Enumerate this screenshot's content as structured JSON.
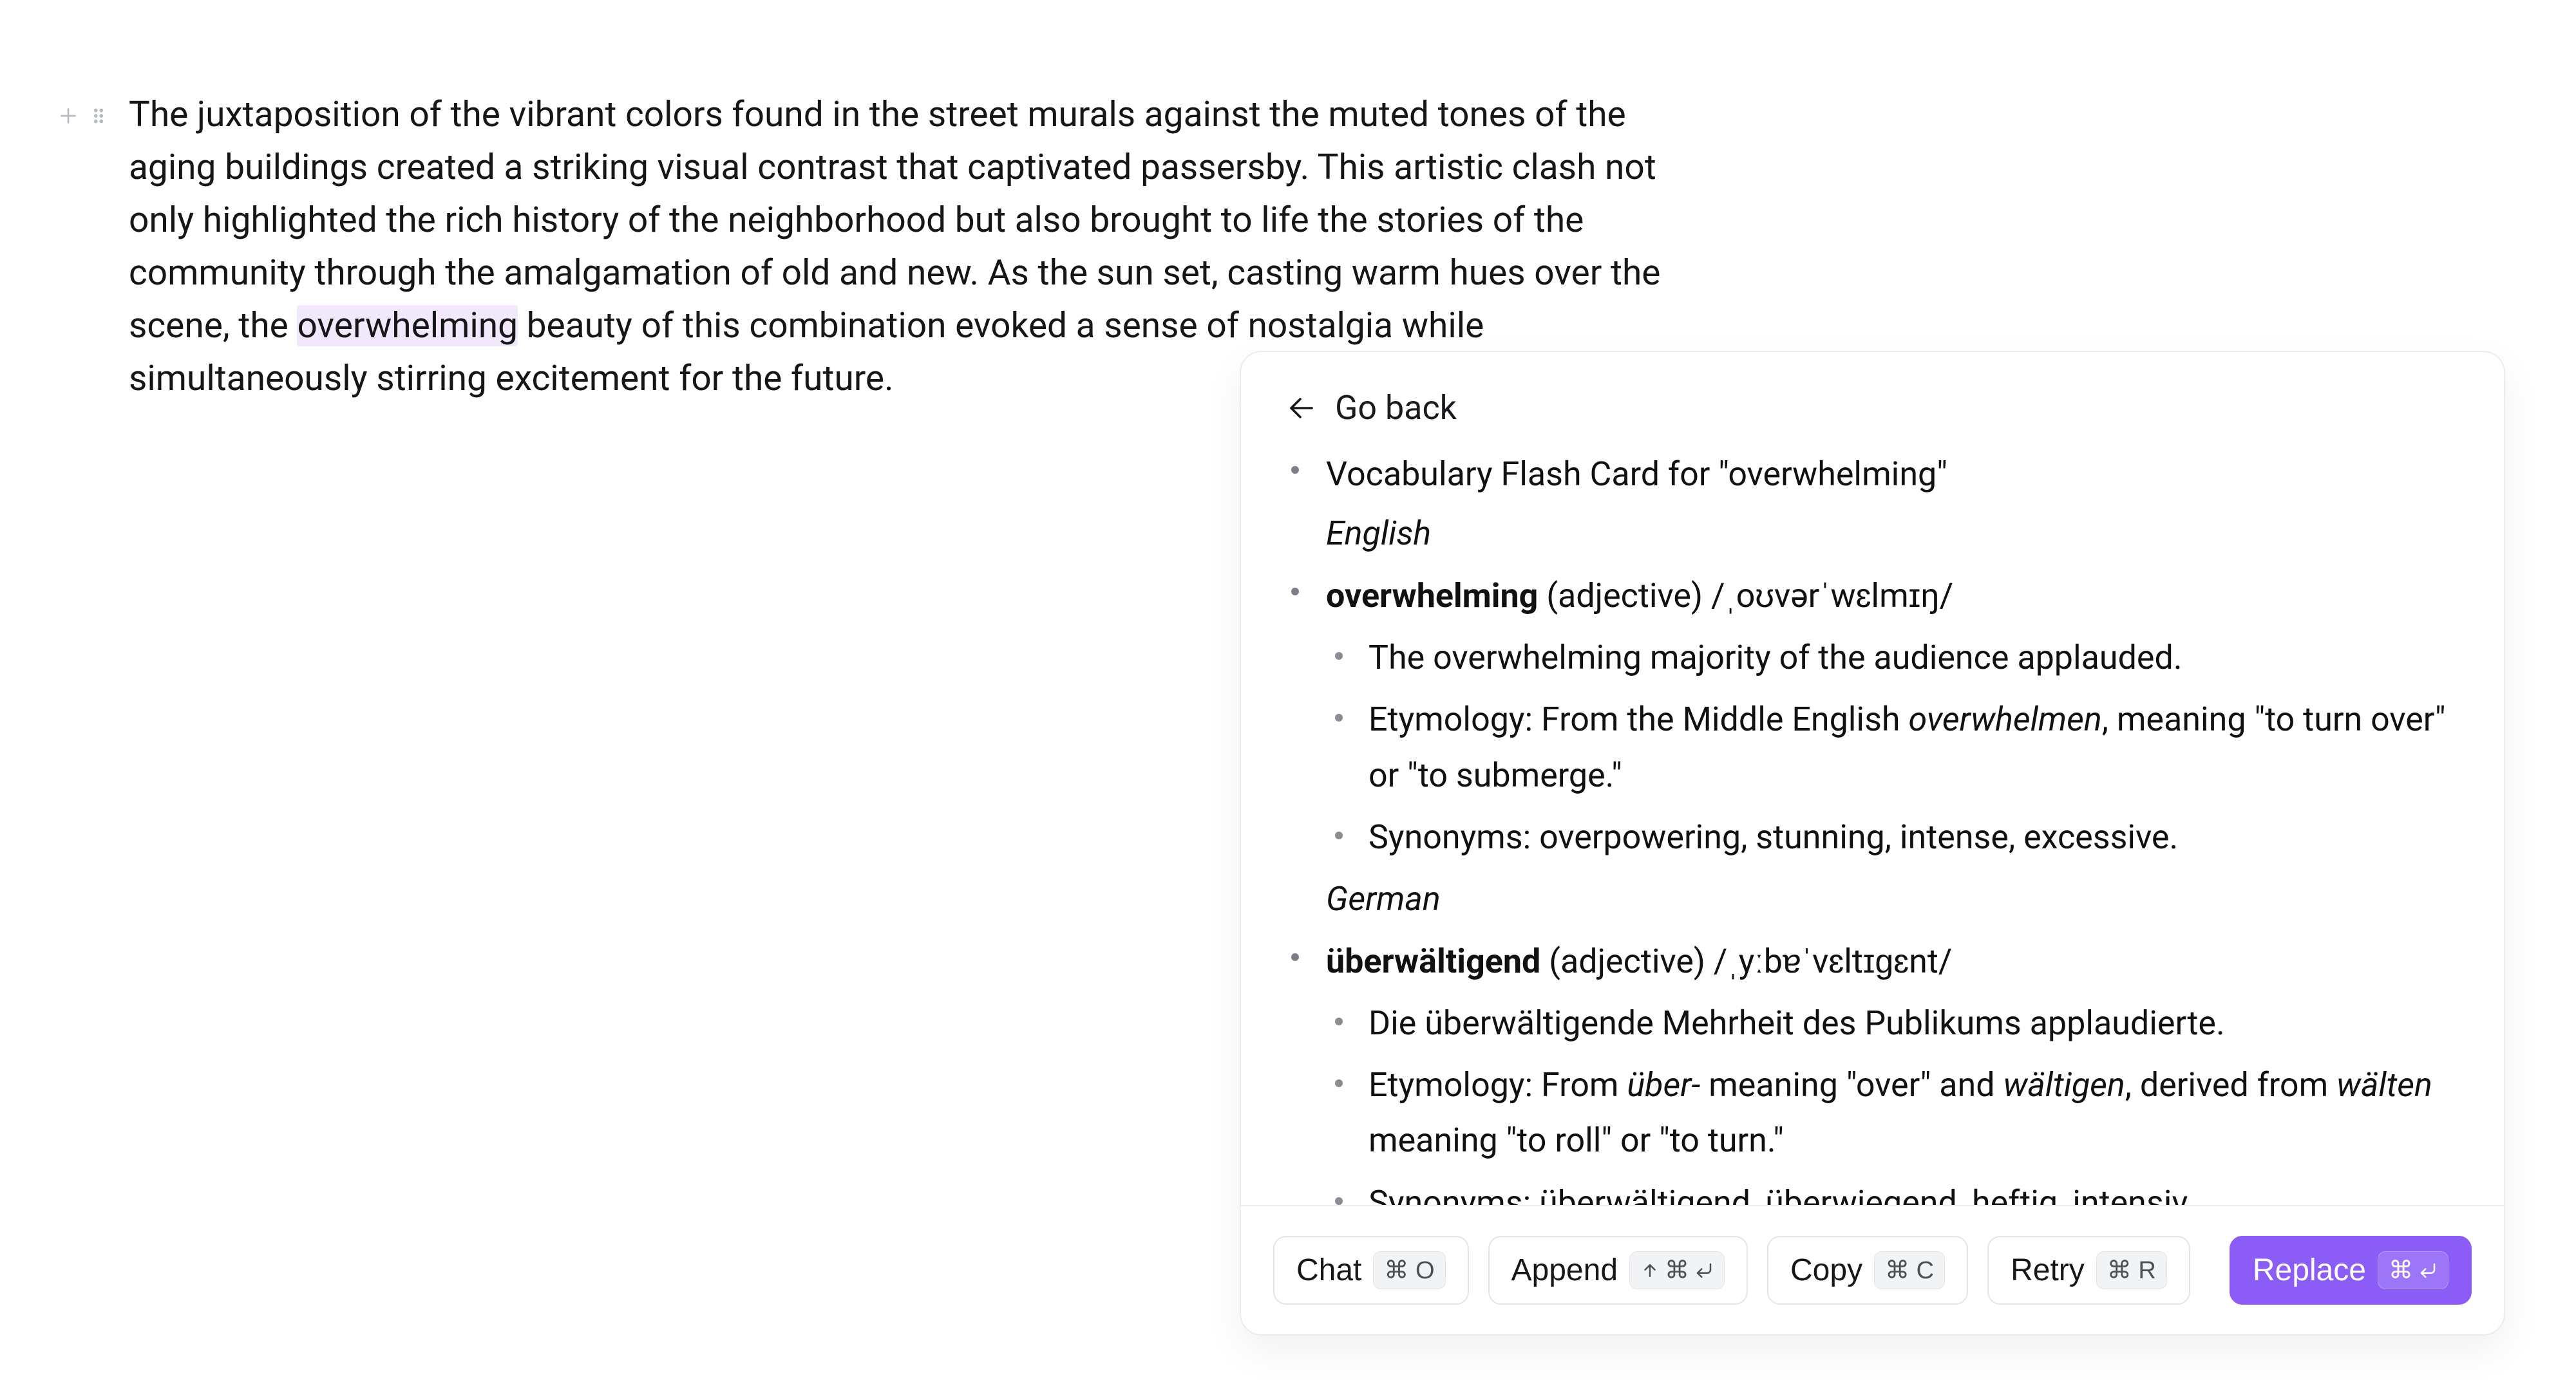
{
  "paragraph": {
    "before": "The juxtaposition of the vibrant colors found in the street murals against the muted tones of the aging buildings created a striking visual contrast that captivated passersby. This artistic clash not only highlighted the rich history of the neighborhood but also brought to life the stories of the community through the amalgamation of old and new. As the sun set, casting warm hues over the scene, the ",
    "highlight": "overwhelming",
    "after": " beauty of this combination evoked a sense of nostalgia while simultaneously stirring excitement for the future."
  },
  "popover": {
    "go_back": "Go back",
    "card": {
      "title": "Vocabulary Flash Card for \"overwhelming\"",
      "lang1": "English",
      "entry1": {
        "word": "overwhelming",
        "pos": " (adjective) ",
        "ipa": "/ˌoʊvərˈwɛlmɪŋ/",
        "example": "The overwhelming majority of the audience applauded.",
        "ety_pre": "Etymology: From the Middle English ",
        "ety_it": "overwhelmen",
        "ety_post": ", meaning \"to turn over\" or \"to submerge.\"",
        "syn": "Synonyms: overpowering, stunning, intense, excessive."
      },
      "lang2": "German",
      "entry2": {
        "word": "überwältigend",
        "pos": " (adjective) ",
        "ipa": "/ˌyːbɐˈvɛltɪɡɛnt/",
        "example": "Die überwältigende Mehrheit des Publikums applaudierte.",
        "ety_pre": "Etymology: From ",
        "ety_it1": "über-",
        "ety_mid1": " meaning \"over\" and ",
        "ety_it2": "wältigen",
        "ety_mid2": ", derived from ",
        "ety_it3": "wälten",
        "ety_post": " meaning \"to roll\" or \"to turn.\"",
        "syn": "Synonyms: überwältigend, überwiegend, heftig, intensiv"
      }
    },
    "buttons": {
      "chat": "Chat",
      "chat_k": "⌘ O",
      "append": "Append",
      "copy": "Copy",
      "copy_k": "⌘ C",
      "retry": "Retry",
      "retry_k": "⌘ R",
      "replace": "Replace"
    }
  }
}
